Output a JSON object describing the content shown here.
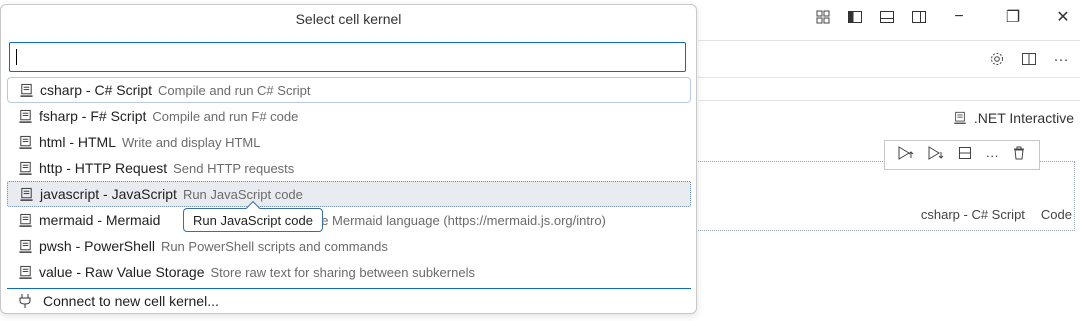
{
  "quickpick": {
    "title": "Select cell kernel",
    "input_value": "",
    "items": [
      {
        "name": "csharp - C# Script",
        "desc": "Compile and run C# Script"
      },
      {
        "name": "fsharp - F# Script",
        "desc": "Compile and run F# code"
      },
      {
        "name": "html - HTML",
        "desc": "Write and display HTML"
      },
      {
        "name": "http - HTTP Request",
        "desc": "Send HTTP requests"
      },
      {
        "name": "javascript - JavaScript",
        "desc": "Run JavaScript code"
      },
      {
        "name": "mermaid - Mermaid",
        "desc": "the Mermaid language (https://mermaid.js.org/intro)"
      },
      {
        "name": "pwsh - PowerShell",
        "desc": "Run PowerShell scripts and commands"
      },
      {
        "name": "value - Raw Value Storage",
        "desc": "Store raw text for sharing between subkernels"
      }
    ],
    "connect_label": "Connect to new cell kernel...",
    "tooltip": "Run JavaScript code"
  },
  "editor": {
    "kernel_label": ".NET Interactive",
    "cell_kernel": "csharp - C# Script",
    "cell_language": "Code"
  },
  "icons": {
    "window_minimize": "−",
    "window_restore": "❐",
    "window_close": "✕",
    "more": "···"
  }
}
